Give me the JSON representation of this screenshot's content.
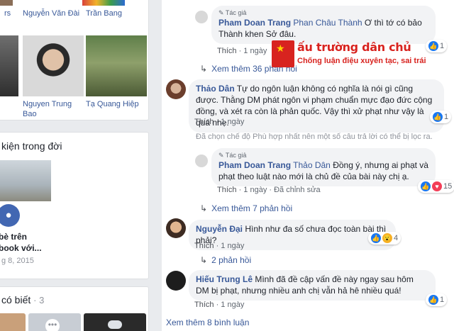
{
  "friends": [
    {
      "name": "Nguyễn Văn Đài"
    },
    {
      "name": "Trần Bang"
    },
    {
      "name": "Nguyen Trung Bao"
    },
    {
      "name": "Tạ Quang Hiệp"
    }
  ],
  "life_events": {
    "title": "kiện trong đời",
    "card_title": "bè trên book với...",
    "card_title_line1": "bè trên",
    "card_title_line2": "book với...",
    "date": "g 8, 2015"
  },
  "people_you_know": {
    "title": "có biết",
    "count": "· 3"
  },
  "watermark": {
    "title": "ấu trường dân chủ",
    "subtitle": "Chống luận điệu xuyên tạc, sai trái"
  },
  "comments": {
    "author_badge": "Tác giả",
    "c1": {
      "author": "Pham Doan Trang",
      "mention": "Phan Châu Thành",
      "text": " Ơ thì tớ có bảo Thành khen Sở đâu.",
      "like": "Thích",
      "time": "1 ngày",
      "reactions": "1"
    },
    "view_more_1": "Xem thêm 36 phản hồi",
    "c2": {
      "author": "Thảo Dân",
      "text": " Tự do ngôn luận không có nghĩa là nói gì cũng được. Thằng DM phát ngôn vi phạm chuẩn mực đạo đức cộng đồng, và xét ra còn là phản quốc. Vậy thì xử phạt như vậy là quá nhẹ.",
      "like": "Thích",
      "time": "1 ngày",
      "reactions": "1"
    },
    "filter_notice": "Đã chọn chế độ Phù hợp nhất nên một số câu trả lời có thể bị lọc ra.",
    "c3": {
      "author": "Pham Doan Trang",
      "mention": "Thảo Dân",
      "text": " Đồng ý, nhưng ai phạt và phạt theo luật nào mới là chủ đề của bài này chị ạ.",
      "like": "Thích",
      "time": "1 ngày",
      "edited": "Đã chỉnh sửa",
      "reactions": "15"
    },
    "view_more_2": "Xem thêm 7 phản hồi",
    "c4": {
      "author": "Nguyễn Đại",
      "text": " Hình như đa số chưa đọc toàn bài thì phải?",
      "like": "Thích",
      "time": "1 ngày",
      "reactions": "4"
    },
    "replies_2": "2 phản hồi",
    "c5": {
      "author": "Hiếu Trung Lê",
      "text": " Mình đã đề cập vấn đề này ngay sau hôm DM bị phạt, nhưng nhiều anh chị vẫn hả hê nhiều quá!",
      "like": "Thích",
      "time": "1 ngày",
      "reactions": "1"
    },
    "view_more_comments": "Xem thêm 8 bình luận"
  },
  "colors": {
    "link": "#385898",
    "watermark_red": "#d8231f",
    "like_blue": "#1877f2"
  }
}
